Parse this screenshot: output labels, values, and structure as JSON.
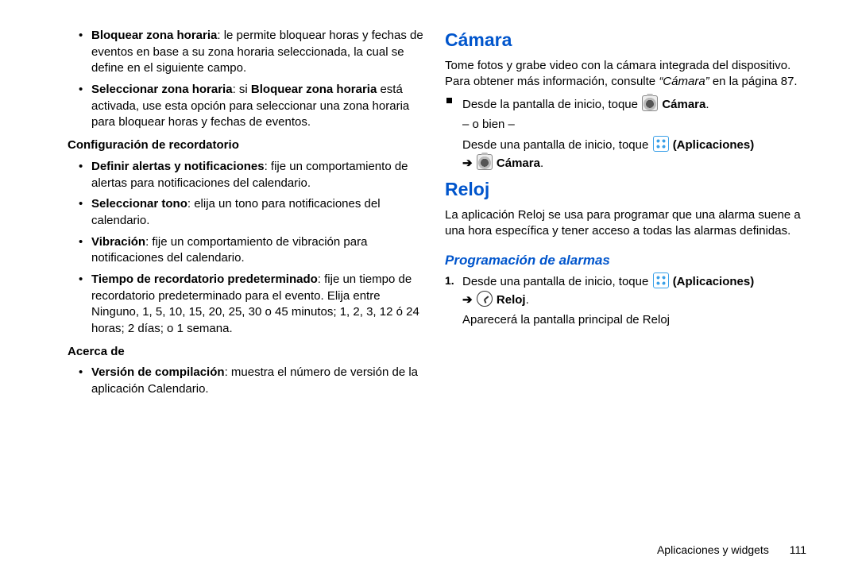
{
  "left": {
    "item1_b": "Bloquear zona horaria",
    "item1_t": ": le permite bloquear horas y fechas de eventos en base a su zona horaria seleccionada, la cual se define en el siguiente campo.",
    "item2_b1": "Seleccionar zona horaria",
    "item2_t1": ": si ",
    "item2_b2": "Bloquear zona horaria",
    "item2_t2": " está activada, use esta opción para seleccionar una zona horaria para bloquear horas y fechas de eventos.",
    "sub1": "Configuración de recordatorio",
    "item3_b": "Definir alertas y notificaciones",
    "item3_t": ": fije un comportamiento de alertas para notificaciones del calendario.",
    "item4_b": "Seleccionar tono",
    "item4_t": ": elija un tono para notificaciones del calendario.",
    "item5_b": "Vibración",
    "item5_t": ": fije un comportamiento de vibración para notificaciones del calendario.",
    "item6_b": "Tiempo de recordatorio predeterminado",
    "item6_t": ": fije un tiempo de recordatorio predeterminado para el evento. Elija entre Ninguno, 1, 5, 10, 15, 20, 25, 30 o 45 minutos; 1, 2, 3, 12 ó 24 horas; 2 días; o 1 semana.",
    "sub2": "Acerca de",
    "item7_b": "Versión de compilación",
    "item7_t": ": muestra el número de versión de la aplicación Calendario."
  },
  "right": {
    "h_cam": "Cámara",
    "cam_p1": "Tome fotos y grabe video con la cámara integrada del dispositivo. Para obtener más información, consulte ",
    "cam_p1_ref": "“Cámara”",
    "cam_p1_end": " en la página 87.",
    "cam_step_a": "Desde la pantalla de inicio, toque ",
    "cam_label": "Cámara",
    "orbien": "– o bien –",
    "cam_step_b": "Desde una pantalla de inicio, toque ",
    "apps_label": "(Aplicaciones)",
    "h_reloj": "Reloj",
    "rel_p": "La aplicación Reloj se usa para programar que una alarma suene a una hora específica y tener acceso a todas las alarmas definidas.",
    "h_prog": "Programación de alarmas",
    "step1_num": "1.",
    "step1_a": "Desde una pantalla de inicio, toque ",
    "reloj_label": "Reloj",
    "result": "Aparecerá la pantalla principal de Reloj"
  },
  "footer": {
    "section": "Aplicaciones y widgets",
    "page": "111"
  }
}
